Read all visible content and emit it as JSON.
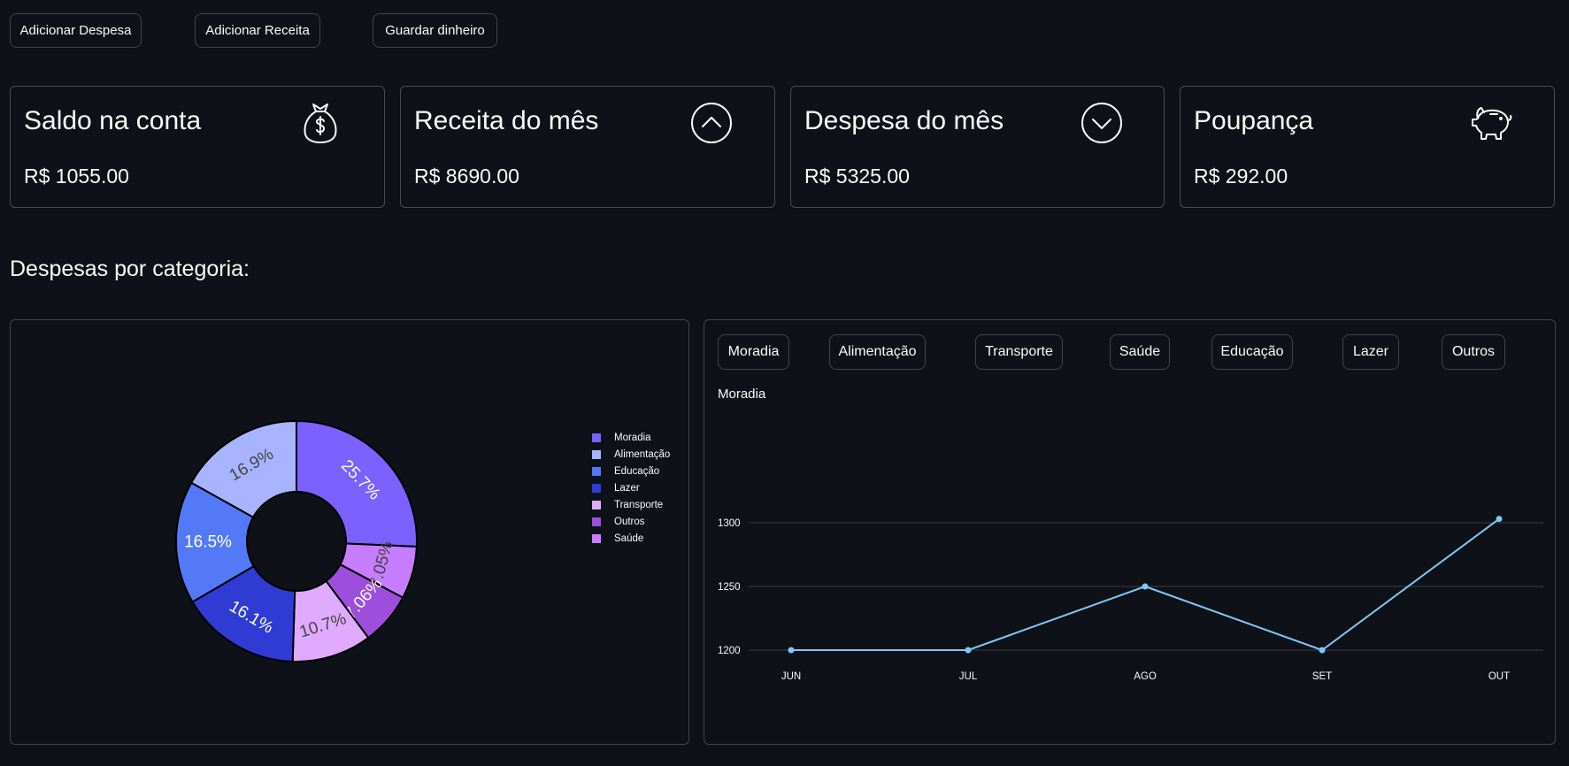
{
  "toolbar": {
    "add_expense": "Adicionar Despesa",
    "add_income": "Adicionar Receita",
    "save_money": "Guardar dinheiro"
  },
  "cards": [
    {
      "title": "Saldo na conta",
      "value": "R$ 1055.00",
      "icon": "money-bag-icon"
    },
    {
      "title": "Receita do mês",
      "value": "R$ 8690.00",
      "icon": "chevron-up-circle-icon"
    },
    {
      "title": "Despesa do mês",
      "value": "R$ 5325.00",
      "icon": "chevron-down-circle-icon"
    },
    {
      "title": "Poupança",
      "value": "R$ 292.00",
      "icon": "piggy-bank-icon"
    }
  ],
  "section_title": "Despesas por categoria:",
  "category_tabs": [
    "Moradia",
    "Alimentação",
    "Transporte",
    "Saúde",
    "Educação",
    "Lazer",
    "Outros"
  ],
  "colors": {
    "background": "#0e1117",
    "line": "#7ec8f5",
    "border": "#3a3d45"
  },
  "chart_data": [
    {
      "type": "pie",
      "title": "",
      "donut": true,
      "slices": [
        {
          "label": "Moradia",
          "percent": 25.7,
          "text": "25.7%",
          "color": "#7b61ff"
        },
        {
          "label": "Saúde",
          "percent": 7.05,
          "text": "7.05%",
          "color": "#c77dff"
        },
        {
          "label": "Outros",
          "percent": 7.06,
          "text": "7.06%",
          "color": "#9d4edd"
        },
        {
          "label": "Transporte",
          "percent": 10.7,
          "text": "10.7%",
          "color": "#e0aaff"
        },
        {
          "label": "Lazer",
          "percent": 16.1,
          "text": "16.1%",
          "color": "#2f3bd3"
        },
        {
          "label": "Educação",
          "percent": 16.5,
          "text": "16.5%",
          "color": "#5479f7"
        },
        {
          "label": "Alimentação",
          "percent": 16.9,
          "text": "16.9%",
          "color": "#a8b4ff"
        }
      ],
      "legend": {
        "placement": "right",
        "items": [
          {
            "label": "Moradia",
            "color": "#7b61ff"
          },
          {
            "label": "Alimentação",
            "color": "#a8b4ff"
          },
          {
            "label": "Educação",
            "color": "#5479f7"
          },
          {
            "label": "Lazer",
            "color": "#2f3bd3"
          },
          {
            "label": "Transporte",
            "color": "#e0aaff"
          },
          {
            "label": "Outros",
            "color": "#9d4edd"
          },
          {
            "label": "Saúde",
            "color": "#c77dff"
          }
        ]
      }
    },
    {
      "type": "line",
      "title": "Moradia",
      "categories": [
        "JUN",
        "JUL",
        "AGO",
        "SET",
        "OUT"
      ],
      "series": [
        {
          "values": [
            1200,
            1200,
            1250,
            1200,
            1303
          ]
        }
      ],
      "yticks": [
        1200,
        1250,
        1300
      ],
      "ylim": [
        1200,
        1303
      ],
      "grid": true
    }
  ]
}
